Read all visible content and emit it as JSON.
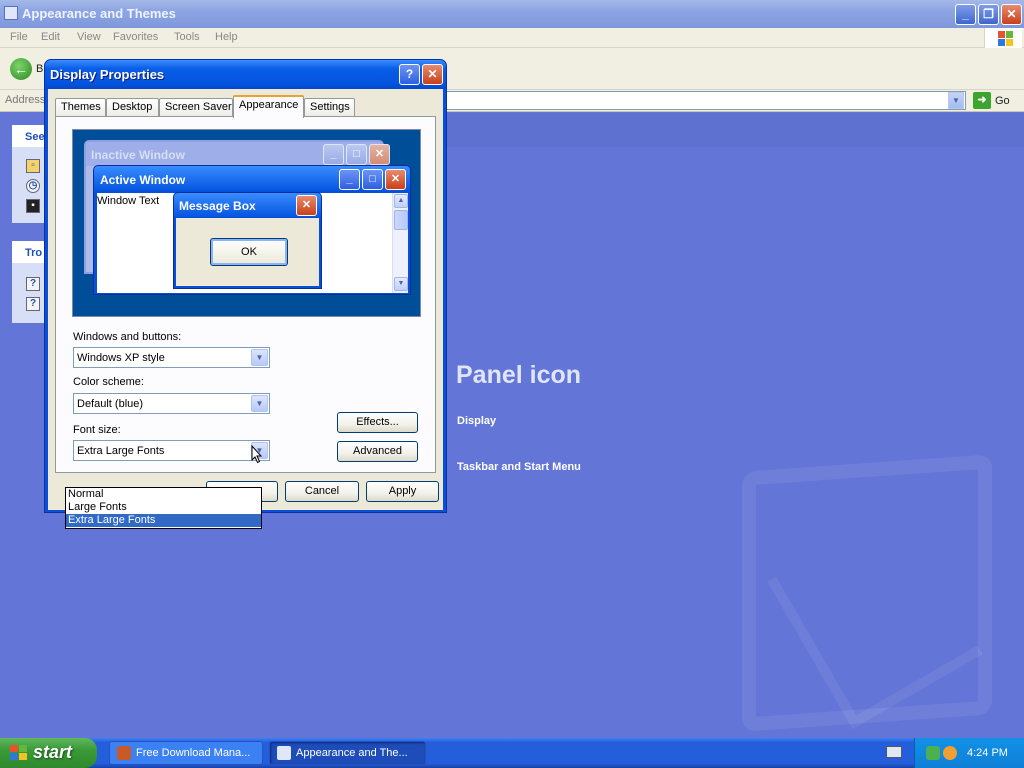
{
  "main_window": {
    "title": "Appearance and Themes",
    "menu": [
      "File",
      "Edit",
      "View",
      "Favorites",
      "Tools",
      "Help"
    ],
    "back_label": "B",
    "address_label": "Address",
    "go_label": "Go"
  },
  "content": {
    "panel1_header": "See",
    "panel2_header": "Tro",
    "heading": "Panel icon",
    "links": [
      "Display",
      "Taskbar and Start Menu"
    ]
  },
  "dialog": {
    "title": "Display Properties",
    "tabs": [
      "Themes",
      "Desktop",
      "Screen Saver",
      "Appearance",
      "Settings"
    ],
    "active_tab": "Appearance",
    "preview": {
      "inactive_title": "Inactive Window",
      "active_title": "Active Window",
      "window_text": "Window Text",
      "message_box_title": "Message Box",
      "ok_label": "OK"
    },
    "windows_buttons_label": "Windows and buttons:",
    "windows_buttons_value": "Windows XP style",
    "color_scheme_label": "Color scheme:",
    "color_scheme_value": "Default (blue)",
    "font_size_label": "Font size:",
    "font_size_value": "Extra Large Fonts",
    "font_size_options": [
      "Normal",
      "Large Fonts",
      "Extra Large Fonts"
    ],
    "effects_label": "Effects...",
    "advanced_label": "Advanced",
    "cancel_label": "Cancel",
    "apply_label": "Apply"
  },
  "taskbar": {
    "start_label": "start",
    "tasks": [
      "Free Download Mana...",
      "Appearance and The..."
    ],
    "clock": "4:24 PM"
  },
  "colors": {
    "xp_blue": "#0a4fd8",
    "content_bg": "#6375d6",
    "start_green": "#3a9a38",
    "selection": "#316ac5"
  }
}
